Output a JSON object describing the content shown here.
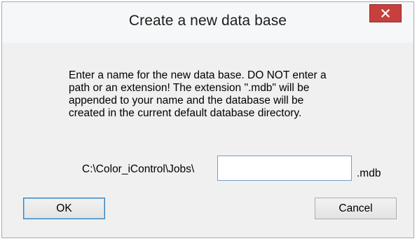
{
  "dialog": {
    "title": "Create a new data base",
    "close_icon": "close-icon",
    "message": "Enter a name for the new data base. DO NOT enter a\npath or an extension! The extension \".mdb\" will be\nappended to your name and the database will be\ncreated in the current default database directory.",
    "path_label": "C:\\Color_iControl\\Jobs\\",
    "name_input": {
      "value": "",
      "placeholder": ""
    },
    "extension_label": ".mdb",
    "ok_label": "OK",
    "cancel_label": "Cancel"
  },
  "colors": {
    "close_button": "#c7403d",
    "window_background": "#f0f0f0",
    "ok_focus_border": "#3c7fb1"
  }
}
